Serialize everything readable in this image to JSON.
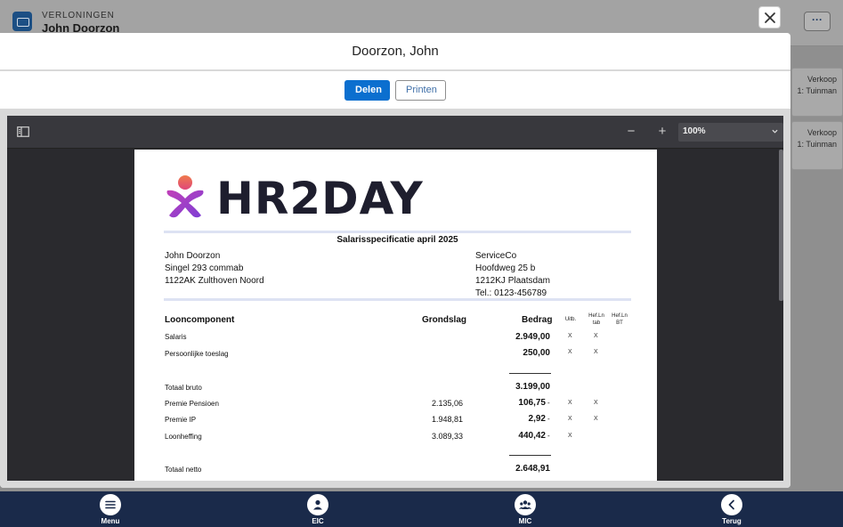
{
  "app": {
    "caption": "VERLONINGEN",
    "title": "John Doorzon",
    "more_label": "···",
    "cards": [
      {
        "line1": "Verkoop",
        "line2": "1: Tuinman"
      },
      {
        "line1": "Verkoop",
        "line2": "1: Tuinman"
      }
    ]
  },
  "modal": {
    "title": "Doorzon, John",
    "share_label": "Delen",
    "print_label": "Printen"
  },
  "viewer": {
    "zoom_out": "−",
    "zoom_in": "+",
    "zoom_value": "100%"
  },
  "payslip": {
    "brand": "HR2DAY",
    "title": "Salarisspecificatie april 2025",
    "employee": {
      "name": "John Doorzon",
      "street": "Singel 293 commab",
      "city": "1122AK Zulthoven Noord"
    },
    "employer": {
      "name": "ServiceCo",
      "street": "Hoofdweg 25 b",
      "city": "1212KJ Plaatsdam",
      "phone": "Tel.: 0123-456789"
    },
    "columns": {
      "component": "Looncomponent",
      "basis": "Grondslag",
      "amount": "Bedrag",
      "uitb": "Uitb.",
      "hefltab_1": "Hef.Ln",
      "hefltab_2": "tab",
      "heflbt_1": "Hef.Ln",
      "heflbt_2": "BT"
    },
    "rows": [
      {
        "label": "Salaris",
        "basis": "",
        "amount": "2.949,00",
        "sign": "",
        "uitb": "X",
        "hefl_tab": "X"
      },
      {
        "label": "Persoonlijke toeslag",
        "basis": "",
        "amount": "250,00",
        "sign": "",
        "uitb": "X",
        "hefl_tab": "X"
      },
      {
        "label": "Totaal bruto",
        "basis": "",
        "amount": "3.199,00",
        "sign": "",
        "uitb": "",
        "hefl_tab": ""
      },
      {
        "label": "Premie Pensioen",
        "basis": "2.135,06",
        "amount": "106,75",
        "sign": "-",
        "uitb": "X",
        "hefl_tab": "X"
      },
      {
        "label": "Premie IP",
        "basis": "1.948,81",
        "amount": "2,92",
        "sign": "-",
        "uitb": "X",
        "hefl_tab": "X"
      },
      {
        "label": "Loonheffing",
        "basis": "3.089,33",
        "amount": "440,42",
        "sign": "-",
        "uitb": "X",
        "hefl_tab": ""
      },
      {
        "label": "Totaal netto",
        "basis": "",
        "amount": "2.648,91",
        "sign": "",
        "uitb": "",
        "hefl_tab": ""
      }
    ]
  },
  "nav": [
    {
      "label": "Menu",
      "icon": "menu-icon"
    },
    {
      "label": "EIC",
      "icon": "person-icon"
    },
    {
      "label": "MIC",
      "icon": "group-icon"
    },
    {
      "label": "Terug",
      "icon": "chevron-left-icon"
    }
  ],
  "colors": {
    "primary": "#0b6fcf",
    "nav_bg": "#1a2a4a",
    "viewer_bg": "#2a2a2e",
    "brand_pink": "#e0477a",
    "brand_purple": "#8a3fd1"
  }
}
